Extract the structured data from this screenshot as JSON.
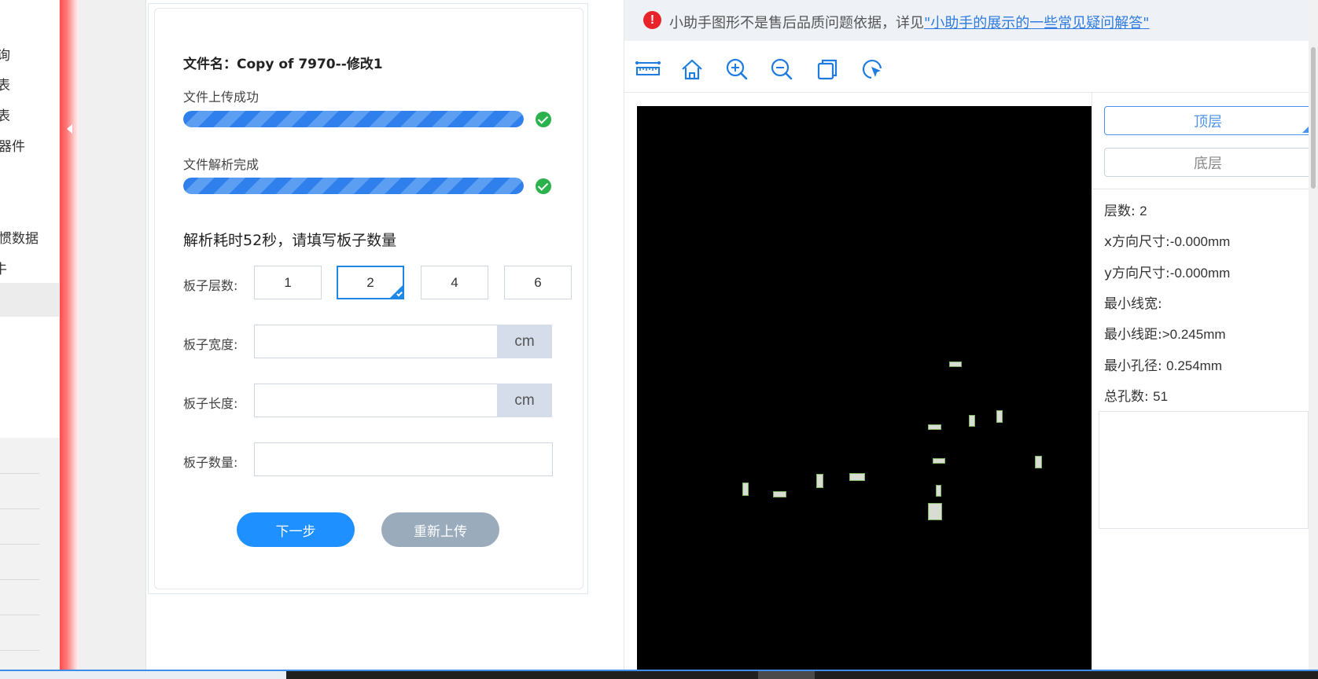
{
  "sidebar": {
    "items": [
      {
        "label": "询"
      },
      {
        "label": "表"
      },
      {
        "label": "表"
      },
      {
        "label": "器件"
      },
      {
        "label": "惯数据"
      },
      {
        "label": "牛"
      }
    ]
  },
  "upload": {
    "file_name": "文件名：Copy of 7970--修改1",
    "upload_status": "文件上传成功",
    "upload_progress": 1.0,
    "parse_status": "文件解析完成",
    "parse_progress": 1.0,
    "prompt": "解析耗时52秒，请填写板子数量",
    "layers_label": "板子层数:",
    "layer_options": [
      "1",
      "2",
      "4",
      "6"
    ],
    "selected_layer": "2",
    "width_label": "板子宽度:",
    "width_value": "",
    "width_unit": "cm",
    "length_label": "板子长度:",
    "length_value": "",
    "length_unit": "cm",
    "quantity_label": "板子数量:",
    "quantity_value": "",
    "next_label": "下一步",
    "reupload_label": "重新上传"
  },
  "viewer": {
    "notice_icon": "!",
    "notice_text": "小助手图形不是售后品质问题依据，详见",
    "notice_link": "\"小助手的展示的一些常见疑问解答\"",
    "tools": [
      "ruler-icon",
      "home-icon",
      "zoom-in-icon",
      "zoom-out-icon",
      "copy-icon",
      "pointer-icon"
    ],
    "layer_tabs": {
      "top": "顶层",
      "bottom": "底层"
    },
    "stats": {
      "layers_label": "层数:",
      "layers_value": "2",
      "x_label": "x方向尺寸:",
      "x_value": "-0.000mm",
      "y_label": "y方向尺寸:",
      "y_value": "-0.000mm",
      "min_width_label": "最小线宽:",
      "min_width_value": "",
      "min_spacing_label": "最小线距:",
      "min_spacing_value": ">0.245mm",
      "min_hole_label": "最小孔径:",
      "min_hole_value": "0.254mm",
      "total_holes_label": "总孔数:",
      "total_holes_value": "51"
    }
  },
  "colors": {
    "accent": "#1e90ff",
    "secondary_button": "#9aabbc",
    "success": "#2bb24c",
    "warning": "#e8232a",
    "link": "#2f7be0",
    "board_background": "#000000"
  }
}
